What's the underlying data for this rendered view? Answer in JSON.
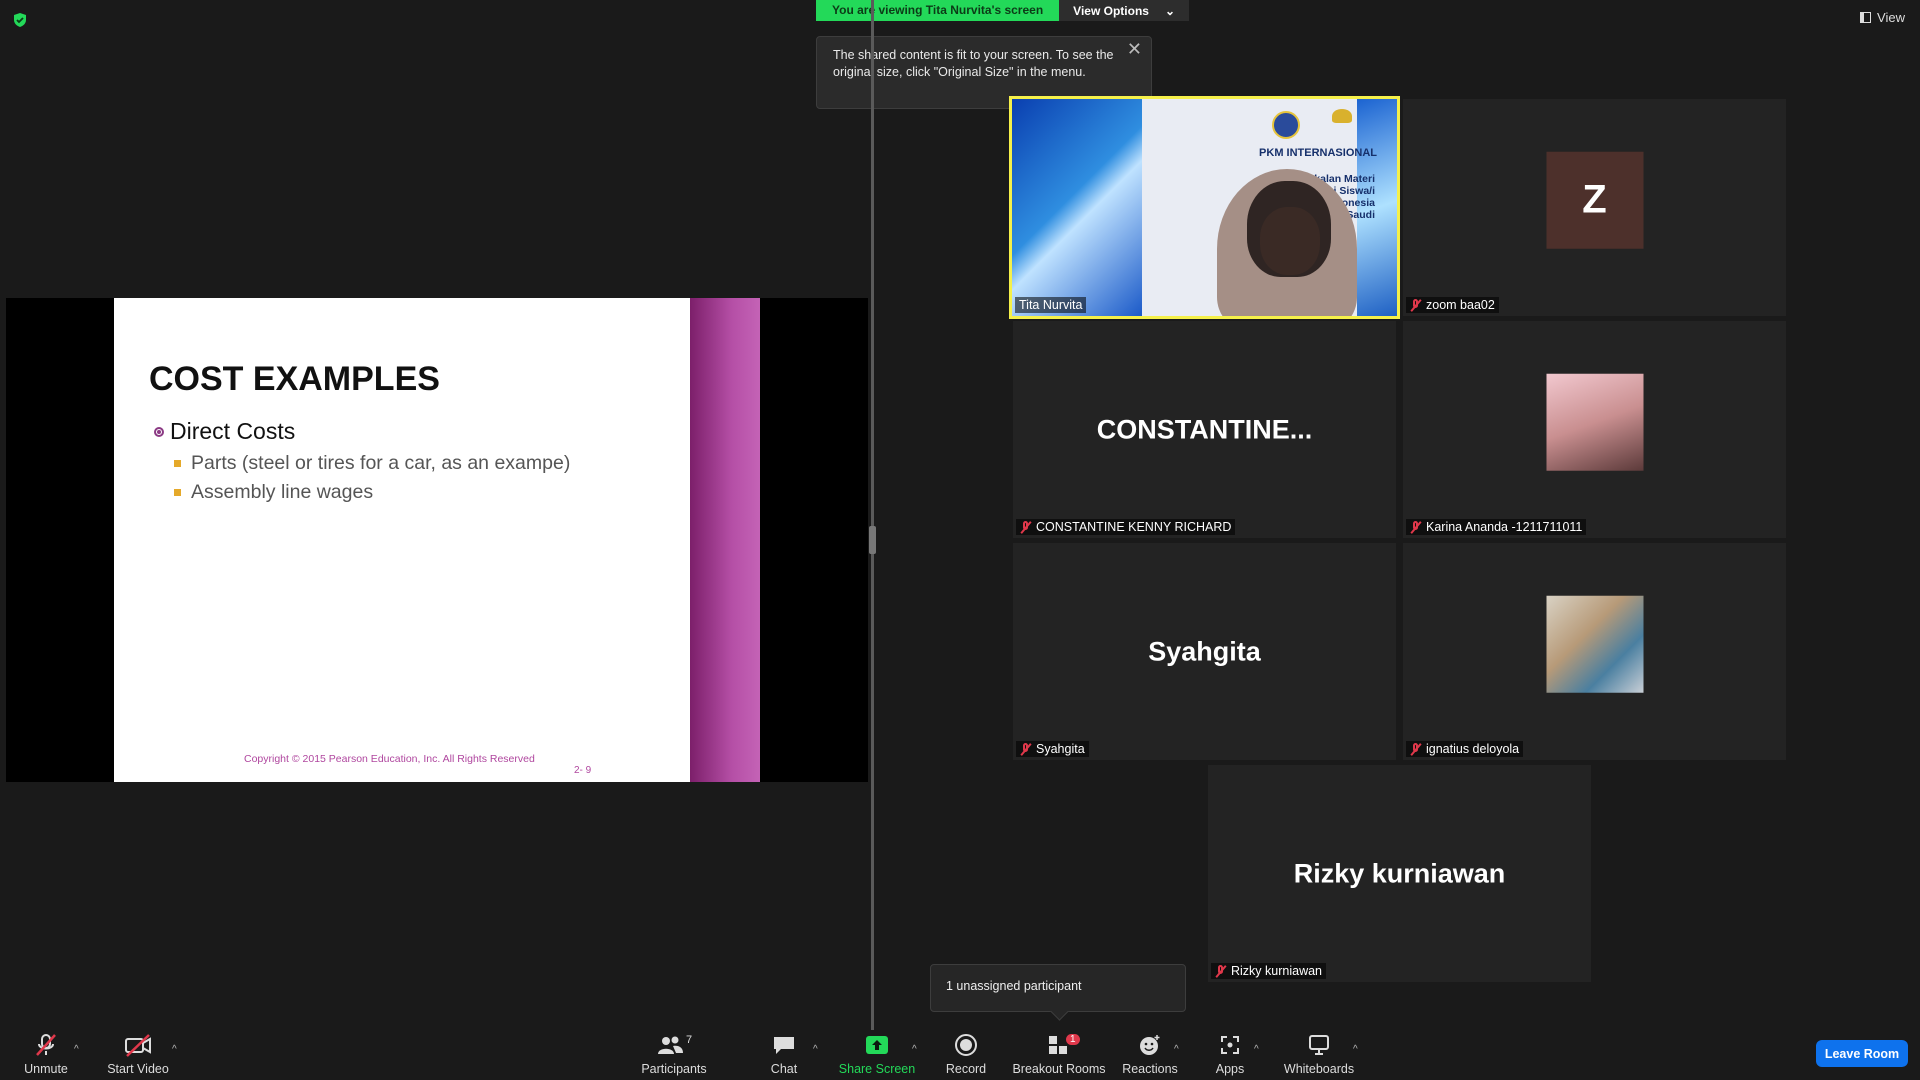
{
  "banner": {
    "viewing": "You are viewing Tita Nurvita's screen",
    "view_options": "View Options"
  },
  "top_right": {
    "view_label": "View"
  },
  "tip": {
    "text": "The shared content is fit to your screen. To see the original size, click \"Original Size\" in the menu."
  },
  "slide": {
    "title": "COST EXAMPLES",
    "bullet": "Direct Costs",
    "sub_bullets": [
      "Parts (steel or tires for a car, as an exampe)",
      "Assembly line wages"
    ],
    "copyright": "Copyright © 2015 Pearson Education, Inc. All Rights Reserved",
    "page": "2-   9"
  },
  "tita_bg": {
    "heading": "PKM INTERNASIONAL",
    "sub": "Pembekalan Materi\nBagi Siswa/i\nIndonesia\nArab Saudi"
  },
  "participants": [
    {
      "name": "Tita Nurvita"
    },
    {
      "name": "zoom baa02",
      "initial": "Z",
      "avatar_color": "#4d302b"
    },
    {
      "name": "CONSTANTINE KENNY RICHARD",
      "display": "CONSTANTINE..."
    },
    {
      "name": "Karina Ananda -1211711011"
    },
    {
      "name": "Syahgita",
      "display": "Syahgita"
    },
    {
      "name": "ignatius deloyola"
    },
    {
      "name": "Rizky kurniawan",
      "display": "Rizky kurniawan"
    }
  ],
  "toolbar": {
    "unmute": "Unmute",
    "start_video": "Start Video",
    "participants": "Participants",
    "participants_count": "7",
    "chat": "Chat",
    "share_screen": "Share Screen",
    "record": "Record",
    "breakout_rooms": "Breakout Rooms",
    "breakout_badge": "1",
    "reactions": "Reactions",
    "apps": "Apps",
    "whiteboards": "Whiteboards",
    "leave": "Leave Room"
  },
  "tooltip": {
    "text": "1 unassigned participant"
  },
  "colors": {
    "share_green": "#23d959",
    "leave_blue": "#0e72ed",
    "highlight": "#f5f04a",
    "mute_red": "#e0384b"
  }
}
